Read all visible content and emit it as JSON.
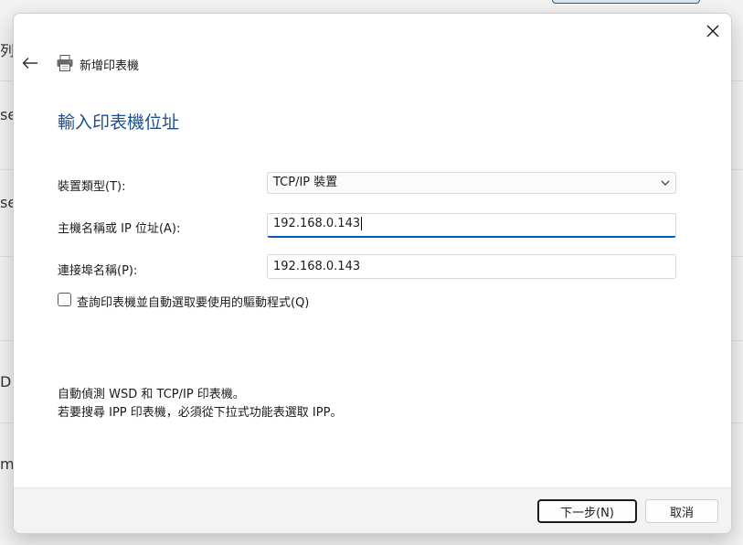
{
  "background": {
    "edge_fragments": [
      "列印",
      "se",
      "se",
      "D",
      "m"
    ]
  },
  "dialog": {
    "wizard_title": "新增印表機",
    "heading": "輸入印表機位址",
    "form": {
      "device_type_label": "裝置類型(T):",
      "device_type_value": "TCP/IP 裝置",
      "host_label": "主機名稱或 IP 位址(A):",
      "host_value": "192.168.0.143",
      "port_label": "連接埠名稱(P):",
      "port_value": "192.168.0.143",
      "query_checkbox_label": "查詢印表機並自動選取要使用的驅動程式(Q)",
      "query_checked": false
    },
    "info_lines": [
      "自動偵測 WSD 和 TCP/IP 印表機。",
      "若要搜尋 IPP 印表機，必須從下拉式功能表選取 IPP。"
    ],
    "buttons": {
      "next": "下一步(N)",
      "cancel": "取消"
    }
  },
  "icons": {
    "close": "close-icon",
    "back": "back-arrow-icon",
    "printer": "printer-icon",
    "dropdown": "chevron-down-icon"
  }
}
